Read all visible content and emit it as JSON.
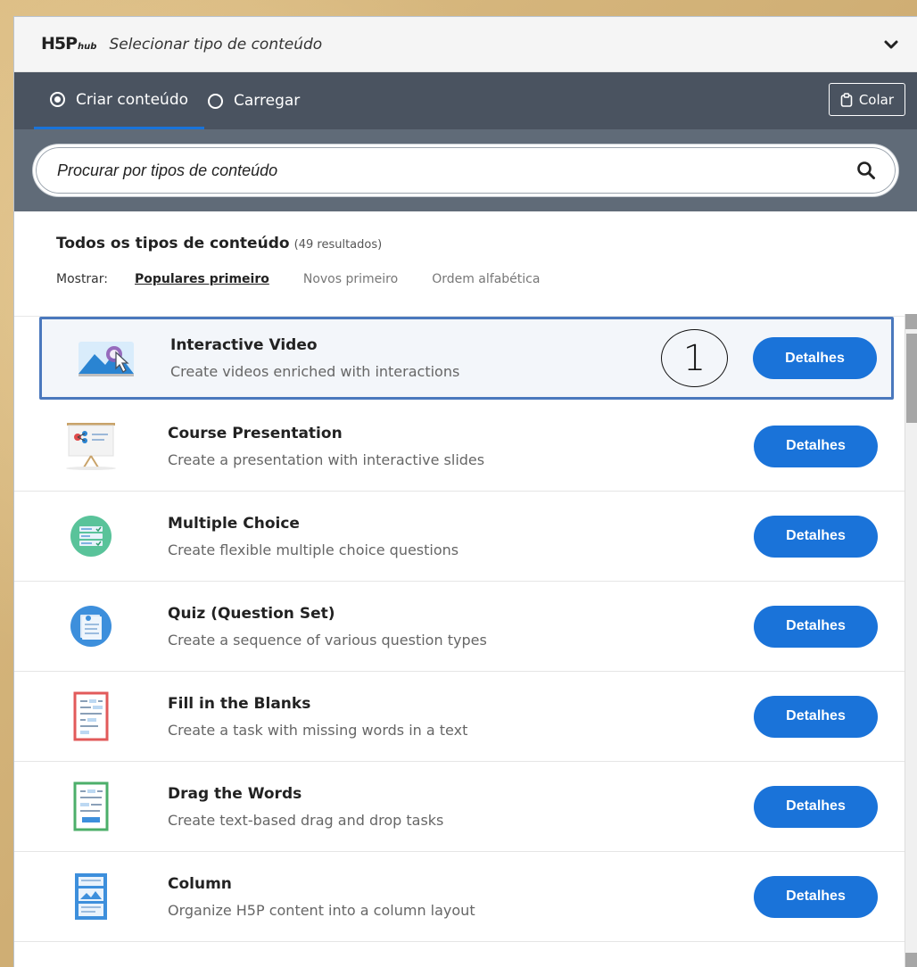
{
  "header": {
    "logo_main": "H5P",
    "logo_sub": "hub",
    "title": "Selecionar tipo de conteúdo",
    "toggle_icon": "chevron-down-icon"
  },
  "tabs": [
    {
      "label": "Criar conteúdo",
      "selected": true
    },
    {
      "label": "Carregar",
      "selected": false
    }
  ],
  "paste_button": {
    "label": "Colar",
    "icon": "clipboard-icon"
  },
  "search": {
    "placeholder": "Procurar por tipos de conteúdo",
    "icon": "search-icon"
  },
  "filter": {
    "title": "Todos os tipos de conteúdo",
    "count": "(49 resultados)",
    "show_label": "Mostrar:",
    "sort_options": [
      {
        "label": "Populares primeiro",
        "selected": true
      },
      {
        "label": "Novos primeiro",
        "selected": false
      },
      {
        "label": "Ordem alfabética",
        "selected": false
      }
    ]
  },
  "annotation_marker": "1",
  "content_types": [
    {
      "title": "Interactive Video",
      "description": "Create videos enriched with interactions",
      "button": "Detalhes",
      "icon": "interactive-video-icon"
    },
    {
      "title": "Course Presentation",
      "description": "Create a presentation with interactive slides",
      "button": "Detalhes",
      "icon": "course-presentation-icon"
    },
    {
      "title": "Multiple Choice",
      "description": "Create flexible multiple choice questions",
      "button": "Detalhes",
      "icon": "multiple-choice-icon"
    },
    {
      "title": "Quiz (Question Set)",
      "description": "Create a sequence of various question types",
      "button": "Detalhes",
      "icon": "question-set-icon"
    },
    {
      "title": "Fill in the Blanks",
      "description": "Create a task with missing words in a text",
      "button": "Detalhes",
      "icon": "fill-in-blanks-icon"
    },
    {
      "title": "Drag the Words",
      "description": "Create text-based drag and drop tasks",
      "button": "Detalhes",
      "icon": "drag-words-icon"
    },
    {
      "title": "Column",
      "description": "Organize H5P content into a column layout",
      "button": "Detalhes",
      "icon": "column-icon"
    }
  ],
  "colors": {
    "accent": "#1a73d9",
    "tabbar": "#4a5360",
    "search_band": "#606b78",
    "highlight_border": "#4a78bd"
  }
}
